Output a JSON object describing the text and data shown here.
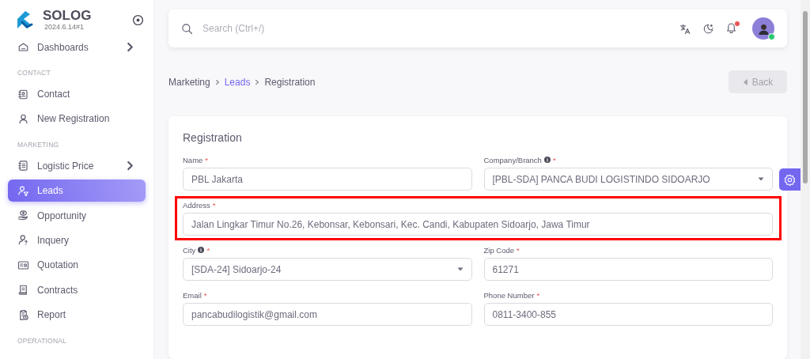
{
  "app": {
    "name": "SOLOG",
    "version": "2024.6.14#1"
  },
  "sidebar": {
    "items": [
      {
        "kind": "item",
        "label": "Dashboards",
        "selected": false,
        "has_submenu": true
      },
      {
        "kind": "section",
        "label": "CONTACT"
      },
      {
        "kind": "item",
        "label": "Contact",
        "selected": false,
        "has_submenu": false
      },
      {
        "kind": "item",
        "label": "New Registration",
        "selected": false,
        "has_submenu": false
      },
      {
        "kind": "section",
        "label": "MARKETING"
      },
      {
        "kind": "item",
        "label": "Logistic Price",
        "selected": false,
        "has_submenu": true
      },
      {
        "kind": "item",
        "label": "Leads",
        "selected": true,
        "has_submenu": false
      },
      {
        "kind": "item",
        "label": "Opportunity",
        "selected": false,
        "has_submenu": false
      },
      {
        "kind": "item",
        "label": "Inquery",
        "selected": false,
        "has_submenu": false
      },
      {
        "kind": "item",
        "label": "Quotation",
        "selected": false,
        "has_submenu": false
      },
      {
        "kind": "item",
        "label": "Contracts",
        "selected": false,
        "has_submenu": false
      },
      {
        "kind": "item",
        "label": "Report",
        "selected": false,
        "has_submenu": false
      },
      {
        "kind": "section",
        "label": "OPERATIONAL"
      }
    ]
  },
  "header": {
    "search": {
      "placeholder": "Search (Ctrl+/)"
    },
    "notifications_unread": true,
    "user_online": true
  },
  "breadcrumb": [
    {
      "label": "Marketing",
      "link": false
    },
    {
      "label": "Leads",
      "link": true
    },
    {
      "label": "Registration",
      "link": false
    }
  ],
  "back_button": {
    "label": "Back",
    "disabled": true
  },
  "form": {
    "title": "Registration",
    "fields": [
      {
        "kind": "text",
        "label": "Name",
        "marker": "*",
        "info": false,
        "value": "PBL Jakarta",
        "highlighted": false
      },
      {
        "kind": "select",
        "label": "Company/Branch",
        "marker": "*",
        "info": true,
        "value": "[PBL-SDA] PANCA BUDI LOGISTINDO SIDOARJO",
        "highlighted": false
      },
      {
        "kind": "wide_text",
        "label": "Address",
        "marker": "*",
        "info": false,
        "value": "Jalan Lingkar Timur No.26, Kebonsar, Kebonsari, Kec. Candi, Kabupaten Sidoarjo, Jawa Timur",
        "highlighted": true
      },
      {
        "kind": "select",
        "label": "City",
        "marker": "*",
        "info": true,
        "value": "[SDA-24] Sidoarjo-24",
        "highlighted": false
      },
      {
        "kind": "text",
        "label": "Zip Code",
        "marker": "*",
        "info": false,
        "value": "61271",
        "highlighted": false
      },
      {
        "kind": "text",
        "label": "Email",
        "marker": "*",
        "info": false,
        "value": "pancabudilogistik@gmail.com",
        "highlighted": false
      },
      {
        "kind": "text",
        "label": "Phone Number",
        "marker": "*",
        "info": false,
        "value": "0811-3400-855",
        "highlighted": false
      }
    ]
  }
}
